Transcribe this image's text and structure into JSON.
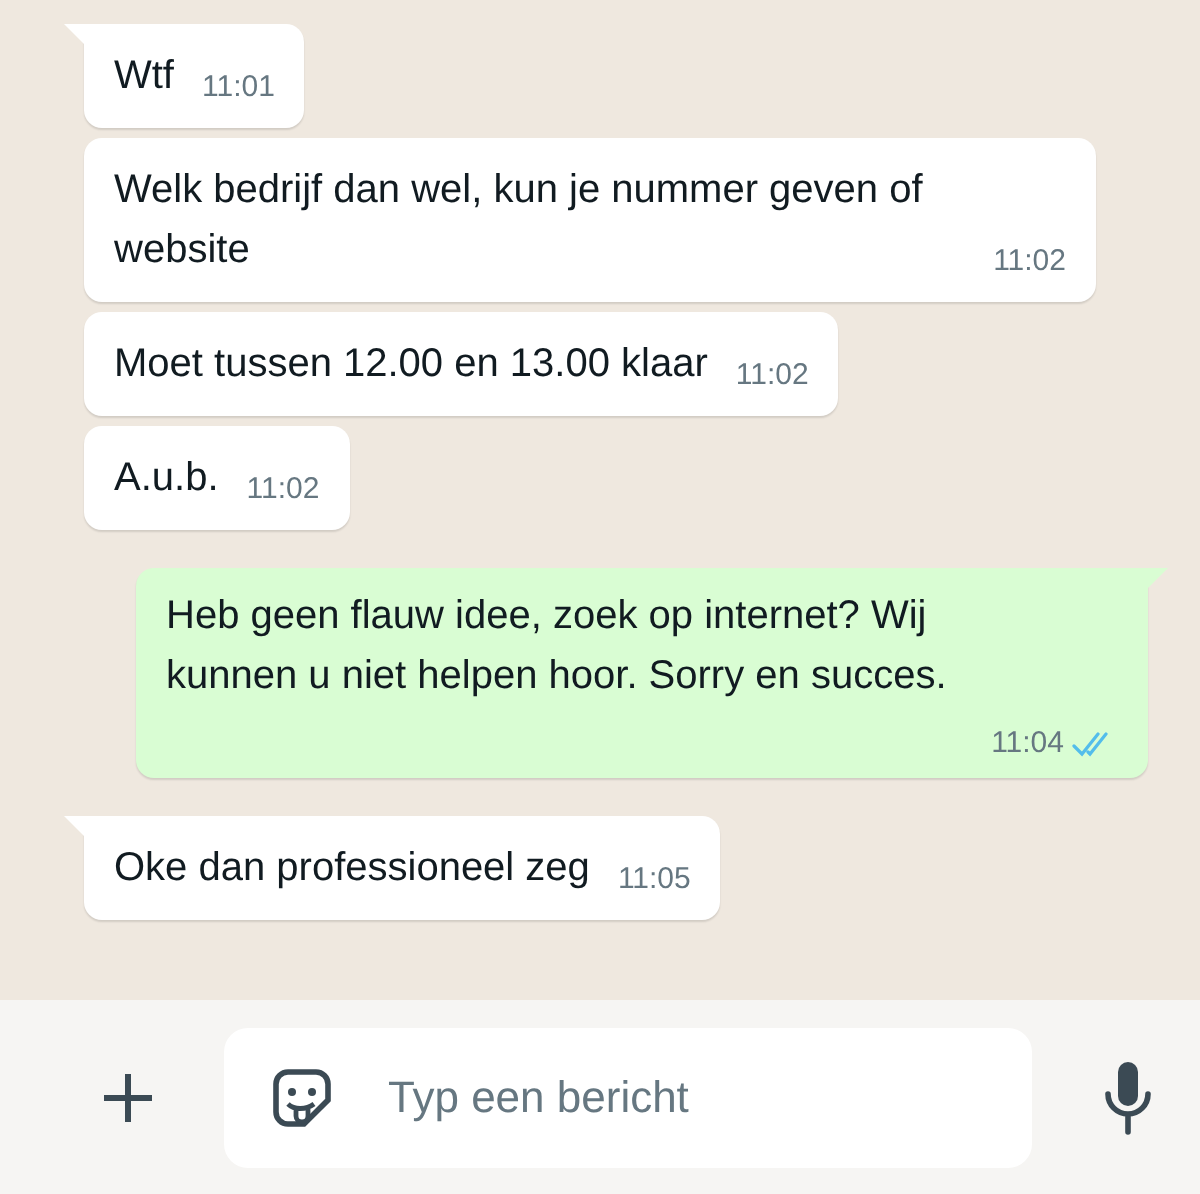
{
  "messages": [
    {
      "kind": "incoming",
      "tail": true,
      "text": "Wtf",
      "time": "11:01"
    },
    {
      "kind": "incoming",
      "tail": false,
      "text": "Welk bedrijf dan wel, kun je nummer geven of website",
      "time": "11:02"
    },
    {
      "kind": "incoming",
      "tail": false,
      "text": "Moet tussen 12.00 en 13.00 klaar",
      "time": "11:02"
    },
    {
      "kind": "incoming",
      "tail": false,
      "text": "A.u.b.",
      "time": "11:02"
    },
    {
      "kind": "outgoing",
      "tail": true,
      "text": "Heb geen flauw idee, zoek op internet? Wij kunnen u niet helpen hoor. Sorry en succes.",
      "time": "11:04",
      "read": true
    },
    {
      "kind": "incoming",
      "tail": true,
      "text": "Oke dan professioneel zeg",
      "time": "11:05"
    }
  ],
  "composer": {
    "placeholder": "Typ een bericht"
  }
}
